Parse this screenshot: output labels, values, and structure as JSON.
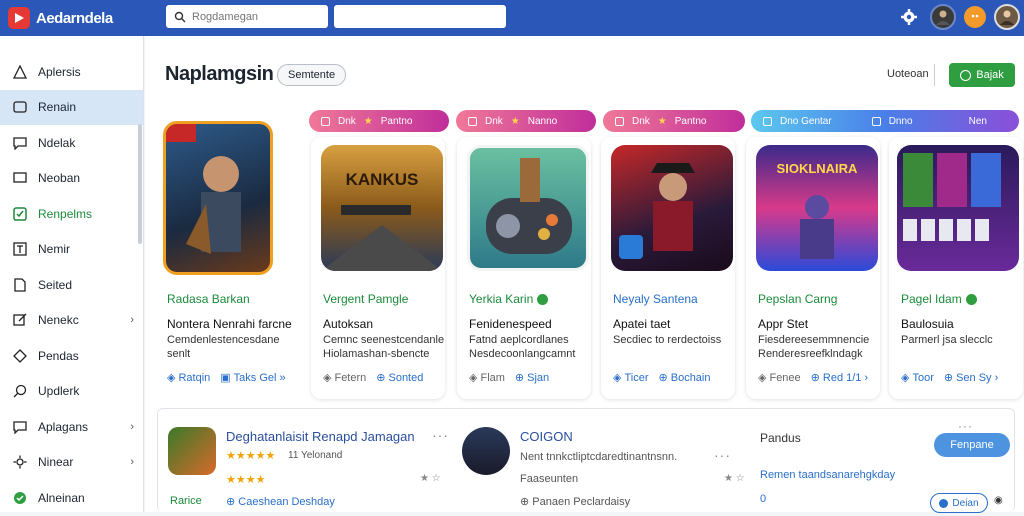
{
  "app": {
    "title": "Aedarndela"
  },
  "search": {
    "placeholder": "Rogdamegan"
  },
  "sidebar": {
    "items": [
      {
        "label": "Aplersis"
      },
      {
        "label": "Renain"
      },
      {
        "label": "Ndelak"
      },
      {
        "label": "Neoban"
      },
      {
        "label": "Renpelms"
      },
      {
        "label": "Nemir"
      },
      {
        "label": "Seited"
      },
      {
        "label": "Nenekc"
      },
      {
        "label": "Pendas"
      },
      {
        "label": "Updlerk"
      },
      {
        "label": "Aplagans"
      },
      {
        "label": "Ninear"
      },
      {
        "label": "Alneinan"
      }
    ]
  },
  "header": {
    "title": "Naplamgsin",
    "chip": "Semtente",
    "sort_label": "Uoteoan",
    "primary_button": "Bajak"
  },
  "pills": [
    {
      "a": "Dnk",
      "b": "Pantno"
    },
    {
      "a": "Dnk",
      "b": "Nanno"
    },
    {
      "a": "Dnk",
      "b": "Pantno"
    },
    {
      "a": "Dno Gentar",
      "b": "Dnno"
    },
    {
      "a": "Nen"
    }
  ],
  "cards": [
    {
      "name": "Radasa Barkan",
      "sub": "Nontera Nenrahi farcne",
      "desc": "Cemdenlestencesdane senlt",
      "act1": "Ratqin",
      "act2": "Taks Gel"
    },
    {
      "name": "Vergent Pamgle",
      "sub": "Autoksan",
      "desc": "Cemnc seenestcendanle Hiolamashan-sbencte",
      "act1": "Fetern",
      "act2": "Sonted",
      "img_text": "KANKUS"
    },
    {
      "name": "Yerkia Karin",
      "sub": "Fenidenespeed",
      "desc": "Fatnd aeplcordlanes Nesdecoonlangcamnt",
      "act1": "Flam",
      "act2": "Sjan"
    },
    {
      "name": "Neyaly Santena",
      "sub": "Apatei taet",
      "desc": "Secdiec to rerdectoiss",
      "act1": "Ticer",
      "act2": "Bochain"
    },
    {
      "name": "Pepslan Carng",
      "sub": "Appr Stet",
      "desc": "Fiesdereesemmnencie Renderesreefklndagk",
      "act1": "Fenee",
      "act2": "Red 1/1",
      "img_text": "SIOKLNAIRA"
    },
    {
      "name": "Pagel Idam",
      "sub": "Baulosuia",
      "desc": "Parmerl jsa slecclc",
      "act1": "Toor",
      "act2": "Sen Sy"
    }
  ],
  "list": [
    {
      "title": "Deghatanlaisit Renapd Jamagan",
      "rating_text": "11 Yelonand",
      "tag": "Rarice",
      "link": "Caeshean Deshday"
    },
    {
      "title": "COIGON",
      "desc": "Nent tnnkctliptcdaredtinantnsnn.",
      "meta": "Faaseunten",
      "link": "Panaen Peclardaisy"
    }
  ],
  "right": {
    "title": "Pandus",
    "link": "Remen taandsanarehgkday",
    "button": "Fenpane",
    "button2": "Deian",
    "count": "0"
  },
  "colors": {
    "topbar": "#2a57b8",
    "accent_green": "#2f9e41",
    "link_blue": "#2a6fc9",
    "pill_pink": "#e8458a",
    "pill_blue": "#4a8fe8"
  }
}
